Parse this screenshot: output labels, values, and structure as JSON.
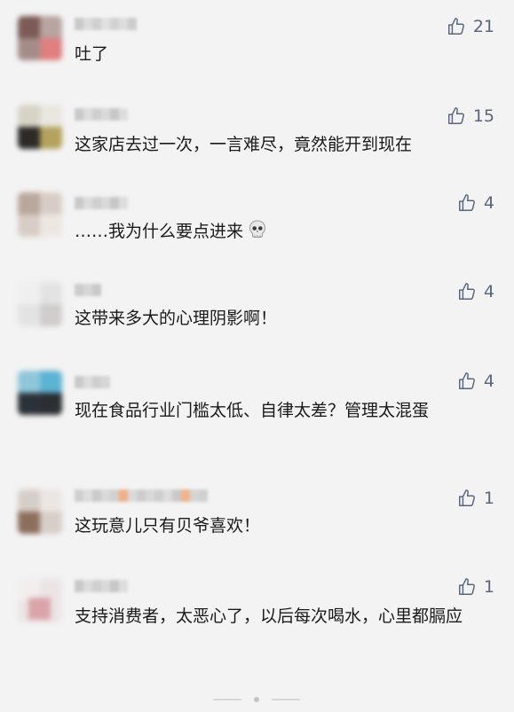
{
  "accent_color": "#58677f",
  "like_icon": "thumbs-up-icon",
  "comments": [
    {
      "likes": "21",
      "text": "吐了"
    },
    {
      "likes": "15",
      "text": "这家店去过一次，一言难尽，竟然能开到现在"
    },
    {
      "likes": "4",
      "text": "……我为什么要点进来",
      "emoji": "skull-icon"
    },
    {
      "likes": "4",
      "text": "这带来多大的心理阴影啊！"
    },
    {
      "likes": "4",
      "text": "现在食品行业门槛太低、自律太差？管理太混蛋"
    },
    {
      "likes": "1",
      "text": "这玩意儿只有贝爷喜欢！"
    },
    {
      "likes": "1",
      "text": "支持消费者，太恶心了，以后每次喝水，心里都膈应"
    }
  ]
}
